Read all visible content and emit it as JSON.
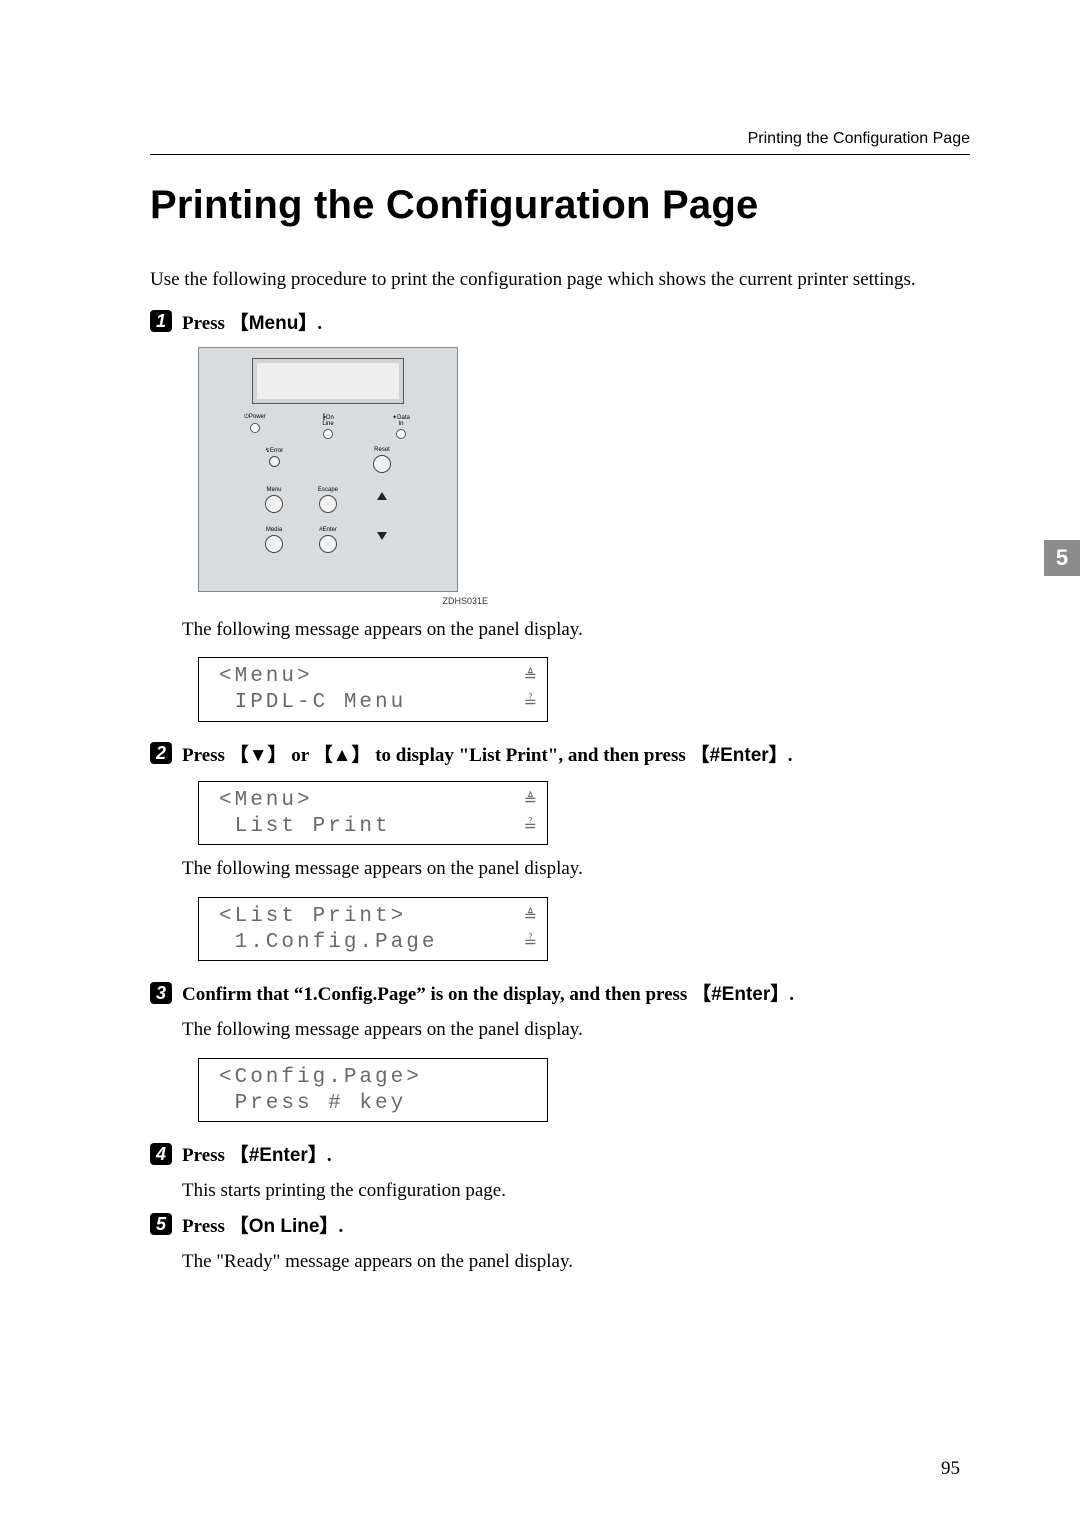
{
  "header": {
    "running_head": "Printing the Configuration Page"
  },
  "title": "Printing the Configuration Page",
  "intro": "Use the following procedure to print the configuration page which shows the current printer settings.",
  "chapter_tab": "5",
  "page_number": "95",
  "panel_figure": {
    "leds": {
      "power": "Power",
      "online": "On Line",
      "datain": "Data In"
    },
    "buttons": {
      "reset": "Reset",
      "error": "Error",
      "menu": "Menu",
      "escape": "Escape",
      "media": "Media",
      "enter": "Enter"
    },
    "id": "ZDHS031E"
  },
  "steps": [
    {
      "num": "1",
      "lead": "Press ",
      "key": "Menu",
      "tail": ".",
      "after_text": "The following message appears on the panel display.",
      "lcd": {
        "l1": "<Menu>",
        "l2": " IPDL-C Menu"
      }
    },
    {
      "num": "2",
      "lead": "Press ",
      "arrow1": "▼",
      "mid1": " or ",
      "arrow2": "▲",
      "mid2": " to display \"List Print\", and then press ",
      "key": "#Enter",
      "tail": ".",
      "lcd1": {
        "l1": "<Menu>",
        "l2": " List Print"
      },
      "after_text": "The following message appears on the panel display.",
      "lcd2": {
        "l1": "<List Print>",
        "l2": " 1.Config.Page"
      }
    },
    {
      "num": "3",
      "lead": "Confirm that “1.Config.Page” is on the display, and then press ",
      "key": "#Enter",
      "tail": ".",
      "after_text": "The following message appears on the panel display.",
      "lcd": {
        "l1": "<Config.Page>",
        "l2": " Press # key"
      }
    },
    {
      "num": "4",
      "lead": "Press ",
      "key": "#Enter",
      "tail": ".",
      "after_text": "This starts printing the configuration page."
    },
    {
      "num": "5",
      "lead": "Press ",
      "key": "On Line",
      "tail": ".",
      "after_text": "The \"Ready\" message appears on the panel display."
    }
  ]
}
